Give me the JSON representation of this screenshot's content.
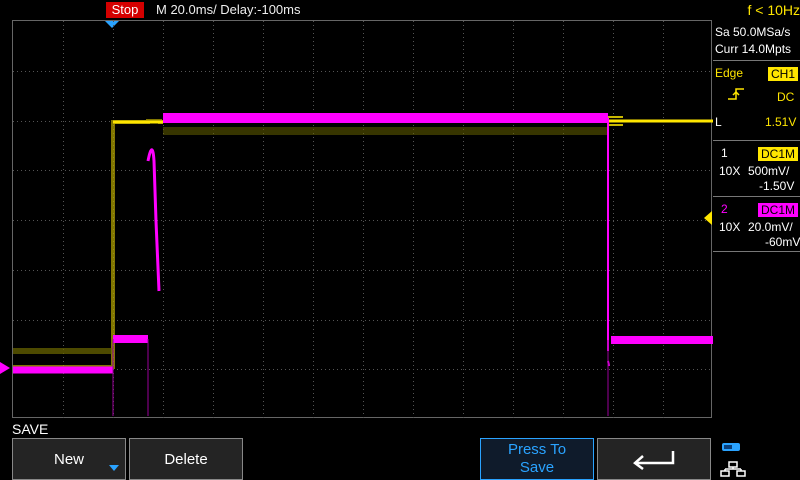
{
  "topbar": {
    "status": "Stop",
    "timebase": "M 20.0ms/ Delay:-100ms",
    "frequency": "f < 10Hz"
  },
  "acquisition": {
    "sample_rate": "Sa 50.0MSa/s",
    "memory_depth": "Curr 14.0Mpts"
  },
  "trigger": {
    "mode": "Edge",
    "source": "CH1",
    "slope_icon": "rising-edge-icon",
    "coupling": "DC",
    "level_prefix": "L",
    "level": "1.51V"
  },
  "channels": [
    {
      "number": "1",
      "coupling": "DC1M",
      "probe": "10X",
      "scale": "500mV/",
      "offset": "-1.50V",
      "color": "#ffe600"
    },
    {
      "number": "2",
      "coupling": "DC1M",
      "probe": "10X",
      "scale": "20.0mV/",
      "offset": "-60mV",
      "color": "#ff00ff"
    }
  ],
  "menu": {
    "title": "SAVE",
    "softkeys": [
      {
        "label": "New"
      },
      {
        "label": "Delete"
      },
      {
        "label_line1": "Press To",
        "label_line2": "Save"
      },
      {
        "icon": "return-arrow-icon"
      }
    ]
  },
  "colors": {
    "ch1": "#ffe600",
    "ch2": "#ff00ff",
    "accent": "#2aa3ff",
    "stop": "#d40000"
  }
}
